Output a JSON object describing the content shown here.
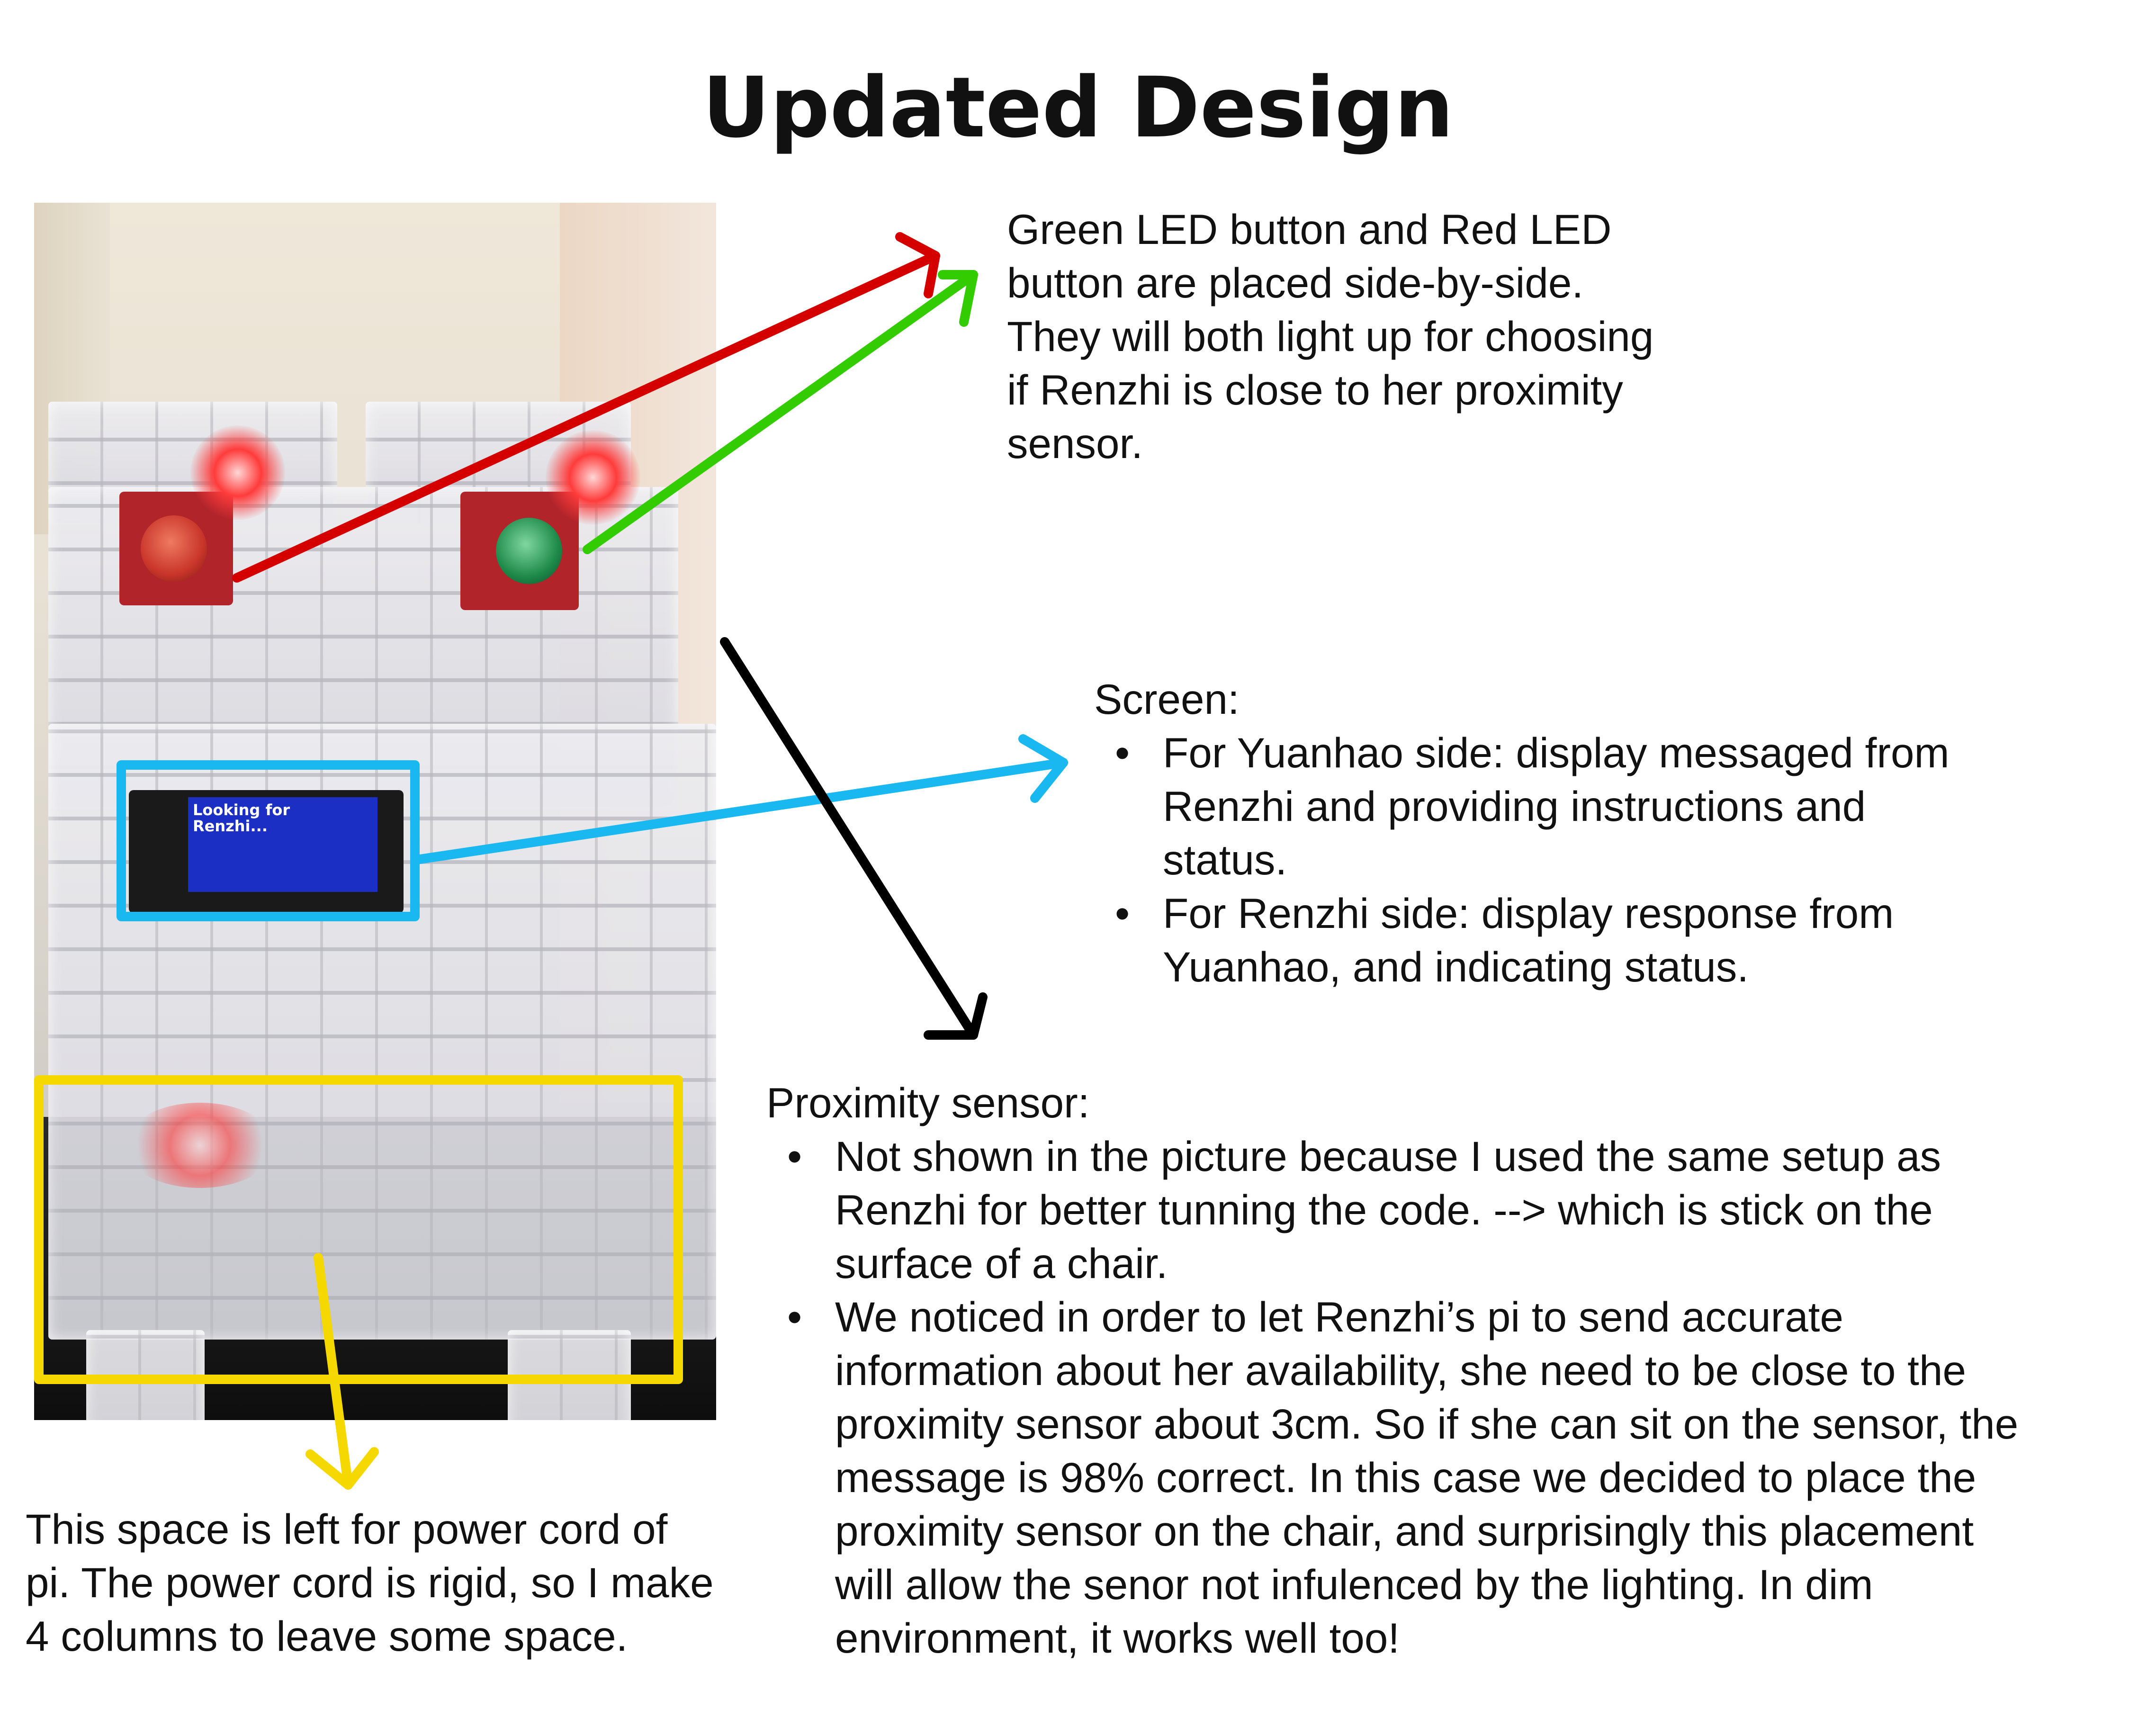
{
  "title": "Updated Design",
  "photo": {
    "screen_text": [
      "Looking for",
      "Renzhi..."
    ]
  },
  "annotations": {
    "buttons": {
      "lines": [
        "Green LED button and Red LED",
        "button are placed side-by-side.",
        "They will both light up for choosing",
        "if Renzhi is close to her proximity",
        "sensor."
      ]
    },
    "screen": {
      "heading": "Screen:",
      "bullet_symbol": "•",
      "bullets": [
        [
          "For Yuanhao side: display messaged from",
          "Renzhi and providing instructions and",
          "status."
        ],
        [
          "For Renzhi side: display response from",
          "Yuanhao, and indicating status."
        ]
      ]
    },
    "proximity": {
      "heading": "Proximity sensor:",
      "bullet_symbol": "•",
      "bullets": [
        [
          "Not shown in the picture because I used the same setup as",
          "Renzhi for better tunning the code. --> which is stick on the",
          "surface of a chair."
        ],
        [
          "We noticed in order to let Renzhi’s pi to send accurate",
          "information about her availability, she need to be close to the",
          "proximity sensor about 3cm. So if she can sit on the sensor, the",
          "message is 98% correct. In this case we decided to place the",
          "proximity sensor on the chair, and surprisingly this placement",
          "will allow the senor not infulenced by the lighting. In dim",
          "environment, it works well too!"
        ]
      ]
    },
    "space": {
      "lines": [
        "This space is left for power cord of",
        "pi. The power cord is rigid, so I make",
        "4 columns to leave some space."
      ]
    }
  },
  "colors": {
    "red_arrow": "#d40000",
    "green_arrow": "#33cc00",
    "blue_box": "#1ab8f0",
    "black_arrow": "#000000",
    "yellow_box": "#f5d800",
    "green_button": "#1e8a4a",
    "red_button": "#d23a2a"
  }
}
